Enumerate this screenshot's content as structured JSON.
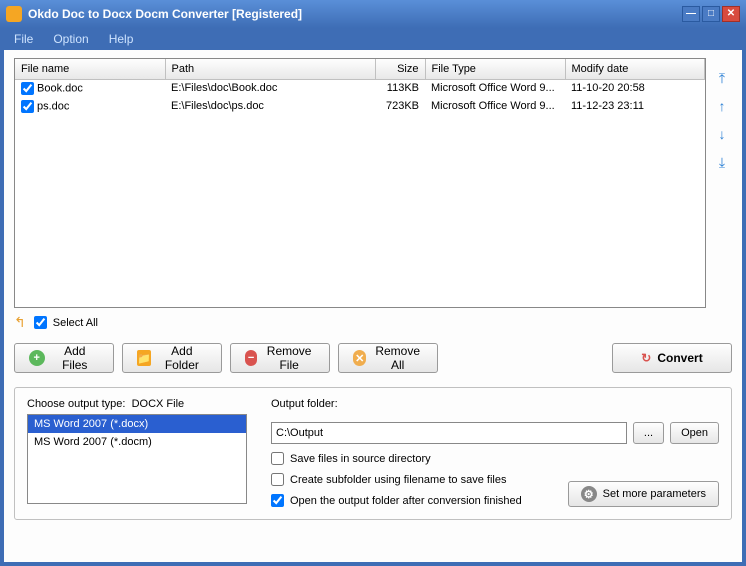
{
  "window": {
    "title": "Okdo Doc to Docx Docm Converter [Registered]"
  },
  "menu": {
    "file": "File",
    "option": "Option",
    "help": "Help"
  },
  "table": {
    "headers": {
      "name": "File name",
      "path": "Path",
      "size": "Size",
      "type": "File Type",
      "date": "Modify date"
    },
    "rows": [
      {
        "checked": true,
        "name": "Book.doc",
        "path": "E:\\Files\\doc\\Book.doc",
        "size": "113KB",
        "type": "Microsoft Office Word 9...",
        "date": "11-10-20 20:58"
      },
      {
        "checked": true,
        "name": "ps.doc",
        "path": "E:\\Files\\doc\\ps.doc",
        "size": "723KB",
        "type": "Microsoft Office Word 9...",
        "date": "11-12-23 23:11"
      }
    ]
  },
  "selectAll": {
    "label": "Select All",
    "checked": true
  },
  "toolbar": {
    "addFiles": "Add Files",
    "addFolder": "Add Folder",
    "removeFile": "Remove File",
    "removeAll": "Remove All",
    "convert": "Convert"
  },
  "output": {
    "chooseTypeLabel": "Choose output type:",
    "currentType": "DOCX File",
    "types": [
      {
        "label": "MS Word 2007 (*.docx)",
        "selected": true
      },
      {
        "label": "MS Word 2007 (*.docm)",
        "selected": false
      }
    ],
    "folderLabel": "Output folder:",
    "folderPath": "C:\\Output",
    "browse": "...",
    "open": "Open",
    "saveSource": {
      "label": "Save files in source directory",
      "checked": false
    },
    "createSub": {
      "label": "Create subfolder using filename to save files",
      "checked": false
    },
    "openAfter": {
      "label": "Open the output folder after conversion finished",
      "checked": true
    },
    "moreParams": "Set more parameters"
  }
}
